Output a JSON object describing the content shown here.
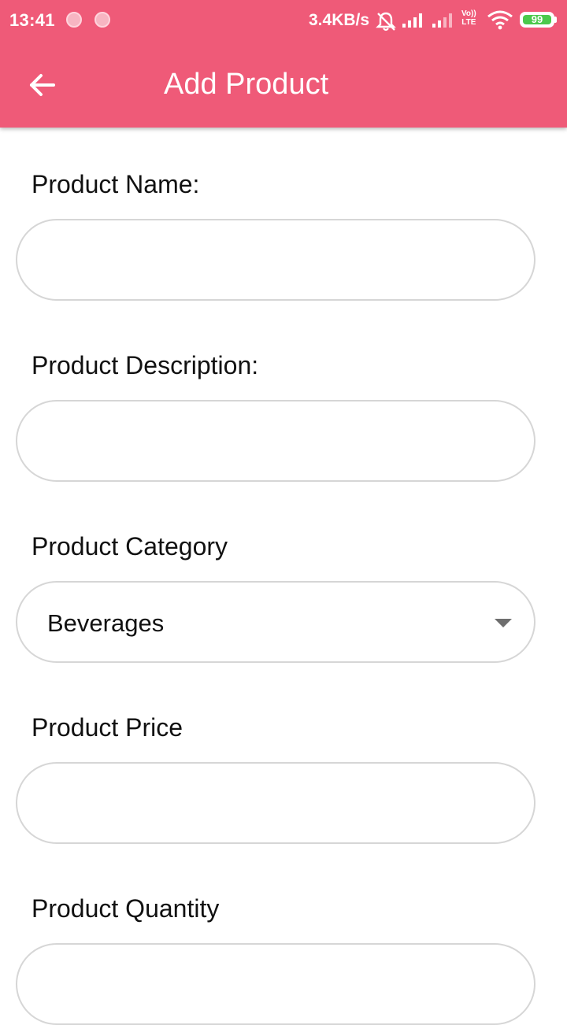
{
  "status_bar": {
    "time": "13:41",
    "network_speed": "3.4KB/s",
    "volte_label_top": "Vo))",
    "volte_label_bottom": "LTE",
    "battery": "99",
    "battery_color": "#4cc94c"
  },
  "app_bar": {
    "title": "Add Product",
    "back_icon": "arrow-left-icon",
    "color": "#ef5a78"
  },
  "form": {
    "product_name": {
      "label": "Product Name:",
      "value": ""
    },
    "product_description": {
      "label": "Product Description:",
      "value": ""
    },
    "product_category": {
      "label": "Product Category",
      "selected": "Beverages"
    },
    "product_price": {
      "label": "Product Price",
      "value": ""
    },
    "product_quantity": {
      "label": "Product Quantity",
      "value": ""
    }
  }
}
